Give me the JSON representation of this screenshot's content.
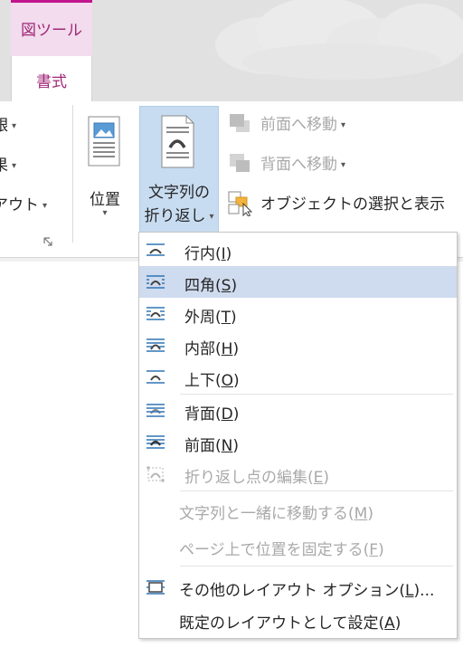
{
  "tool_tab": {
    "label": "図ツール"
  },
  "tabs": {
    "format": "書式"
  },
  "ribbon": {
    "left_items": [
      {
        "text": "銀",
        "caret": "▾"
      },
      {
        "text": "果",
        "caret": "▾"
      },
      {
        "text": "アウト",
        "caret": "▾"
      }
    ],
    "position": {
      "label": "位置",
      "caret": "▾"
    },
    "wrap_text": {
      "line1": "文字列の",
      "line2": "折り返し",
      "caret": "▾"
    },
    "bring_forward": {
      "label": "前面へ移動",
      "caret": "▾"
    },
    "send_backward": {
      "label": "背面へ移動",
      "caret": "▾"
    },
    "selection_pane": {
      "label": "オブジェクトの選択と表示"
    }
  },
  "menu": {
    "items": [
      {
        "label": "行内(",
        "key": "I",
        "tail": ")",
        "icon": "wrap-inline-icon"
      },
      {
        "label": "四角(",
        "key": "S",
        "tail": ")",
        "icon": "wrap-square-icon"
      },
      {
        "label": "外周(",
        "key": "T",
        "tail": ")",
        "icon": "wrap-tight-icon"
      },
      {
        "label": "内部(",
        "key": "H",
        "tail": ")",
        "icon": "wrap-through-icon"
      },
      {
        "label": "上下(",
        "key": "O",
        "tail": ")",
        "icon": "wrap-top-bottom-icon"
      },
      {
        "label": "背面(",
        "key": "D",
        "tail": ")",
        "icon": "wrap-behind-text-icon"
      },
      {
        "label": "前面(",
        "key": "N",
        "tail": ")",
        "icon": "wrap-in-front-icon"
      },
      {
        "label": "折り返し点の編集(",
        "key": "E",
        "tail": ")",
        "icon": "edit-wrap-points-icon"
      }
    ],
    "move_with_text": {
      "label": "文字列と一緒に移動する(",
      "key": "M",
      "tail": ")"
    },
    "fix_position": {
      "label": "ページ上で位置を固定する(",
      "key": "F",
      "tail": ")"
    },
    "more_options": {
      "label": "その他のレイアウト オプション(",
      "key": "L",
      "tail": ")..."
    },
    "set_default": {
      "label": "既定のレイアウトとして設定(",
      "key": "A",
      "tail": ")"
    }
  },
  "colors": {
    "accent": "#a12878",
    "highlight": "#cfdbee",
    "pressed": "#c8dcf1",
    "disabled_text": "#a9a9a9"
  }
}
